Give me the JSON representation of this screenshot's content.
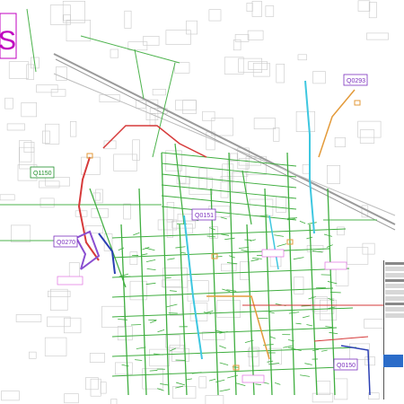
{
  "map": {
    "area_labels": [
      {
        "id": "Q0293",
        "text": "Q0293"
      },
      {
        "id": "Q1150",
        "text": "Q1150"
      },
      {
        "id": "Q0151",
        "text": "Q0151"
      },
      {
        "id": "Q0270",
        "text": "Q0270"
      },
      {
        "id": "Q0150",
        "text": "Q0150"
      }
    ],
    "corner_letter": "S",
    "colors": {
      "road": "#4db34d",
      "pipe_red": "#d63a3a",
      "pipe_cyan": "#3ec7e0",
      "pipe_orange": "#e39a3a",
      "pipe_purple": "#8a4fd1",
      "pipe_blue": "#2b3fb3",
      "label_magenta": "#c000c0",
      "building": "#cfcfcf"
    }
  }
}
